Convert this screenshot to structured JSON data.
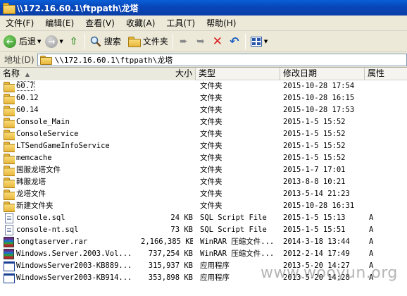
{
  "window": {
    "title": "\\\\172.16.60.1\\ftppath\\龙塔"
  },
  "menu": [
    "文件(F)",
    "编辑(E)",
    "查看(V)",
    "收藏(A)",
    "工具(T)",
    "帮助(H)"
  ],
  "toolbar": {
    "back_label": "后退",
    "search_label": "搜索",
    "folders_label": "文件夹"
  },
  "address": {
    "label": "地址(D)",
    "value": "\\\\172.16.60.1\\ftppath\\龙塔"
  },
  "columns": {
    "name": "名称",
    "size": "大小",
    "type": "类型",
    "modified": "修改日期",
    "attr": "属性"
  },
  "files": [
    {
      "name": "60.7",
      "size": "",
      "type": "文件夹",
      "modified": "2015-10-28 17:54",
      "attr": "",
      "icon": "folder-icon"
    },
    {
      "name": "60.12",
      "size": "",
      "type": "文件夹",
      "modified": "2015-10-28 16:15",
      "attr": "",
      "icon": "folder-icon"
    },
    {
      "name": "60.14",
      "size": "",
      "type": "文件夹",
      "modified": "2015-10-28 17:53",
      "attr": "",
      "icon": "folder-icon"
    },
    {
      "name": "Console_Main",
      "size": "",
      "type": "文件夹",
      "modified": "2015-1-5 15:52",
      "attr": "",
      "icon": "folder-icon"
    },
    {
      "name": "ConsoleService",
      "size": "",
      "type": "文件夹",
      "modified": "2015-1-5 15:52",
      "attr": "",
      "icon": "folder-icon"
    },
    {
      "name": "LTSendGameInfoService",
      "size": "",
      "type": "文件夹",
      "modified": "2015-1-5 15:52",
      "attr": "",
      "icon": "folder-icon"
    },
    {
      "name": "memcache",
      "size": "",
      "type": "文件夹",
      "modified": "2015-1-5 15:52",
      "attr": "",
      "icon": "folder-icon"
    },
    {
      "name": "国服龙塔文件",
      "size": "",
      "type": "文件夹",
      "modified": "2015-1-7 17:01",
      "attr": "",
      "icon": "folder-icon"
    },
    {
      "name": "韩服龙塔",
      "size": "",
      "type": "文件夹",
      "modified": "2013-8-8 10:21",
      "attr": "",
      "icon": "folder-icon"
    },
    {
      "name": "龙塔文件",
      "size": "",
      "type": "文件夹",
      "modified": "2013-5-14 21:23",
      "attr": "",
      "icon": "folder-icon"
    },
    {
      "name": "新建文件夹",
      "size": "",
      "type": "文件夹",
      "modified": "2015-10-28 16:31",
      "attr": "",
      "icon": "folder-icon"
    },
    {
      "name": "console.sql",
      "size": "24 KB",
      "type": "SQL Script File",
      "modified": "2015-1-5 15:13",
      "attr": "A",
      "icon": "sql-file-icon"
    },
    {
      "name": "console-nt.sql",
      "size": "73 KB",
      "type": "SQL Script File",
      "modified": "2015-1-5 15:51",
      "attr": "A",
      "icon": "sql-file-icon"
    },
    {
      "name": "longtaserver.rar",
      "size": "2,166,385 KB",
      "type": "WinRAR 压缩文件...",
      "modified": "2014-3-18 13:44",
      "attr": "A",
      "icon": "rar-archive-icon"
    },
    {
      "name": "Windows.Server.2003.Vol...",
      "size": "737,254 KB",
      "type": "WinRAR 压缩文件...",
      "modified": "2012-2-14 17:49",
      "attr": "A",
      "icon": "rar-archive-icon"
    },
    {
      "name": "WindowsServer2003-KB889...",
      "size": "315,937 KB",
      "type": "应用程序",
      "modified": "2013-5-20 14:27",
      "attr": "A",
      "icon": "executable-icon"
    },
    {
      "name": "WindowsServer2003-KB914...",
      "size": "353,898 KB",
      "type": "应用程序",
      "modified": "2013-5-20 14:28",
      "attr": "A",
      "icon": "executable-icon"
    }
  ],
  "watermark": "www.wooyun.org"
}
